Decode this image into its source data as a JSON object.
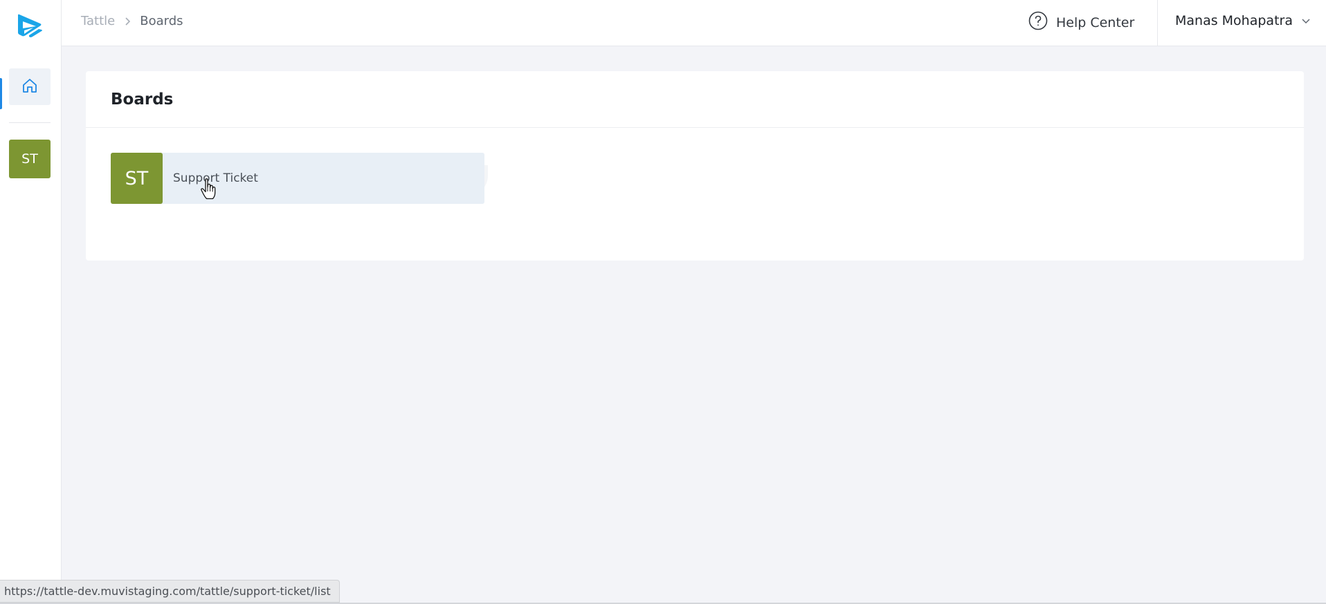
{
  "colors": {
    "accent": "#1e88e5",
    "board_olive": "#7d9632",
    "logo_blue": "#1aa5e8"
  },
  "sidebar": {
    "logo_icon": "tattle-logo-icon",
    "home_icon": "home-icon",
    "boards": [
      {
        "initials": "ST"
      }
    ]
  },
  "header": {
    "breadcrumb": {
      "root": "Tattle",
      "separator_icon": "chevron-right-icon",
      "current": "Boards"
    },
    "help": {
      "icon": "question-circle-icon",
      "label": "Help Center"
    },
    "user": {
      "name": "Manas Mohapatra",
      "icon": "chevron-down-icon"
    }
  },
  "main": {
    "title": "Boards",
    "boards": [
      {
        "initials": "ST",
        "name": "Support Ticket"
      }
    ]
  },
  "status_bar": {
    "url": "https://tattle-dev.muvistaging.com/tattle/support-ticket/list"
  }
}
